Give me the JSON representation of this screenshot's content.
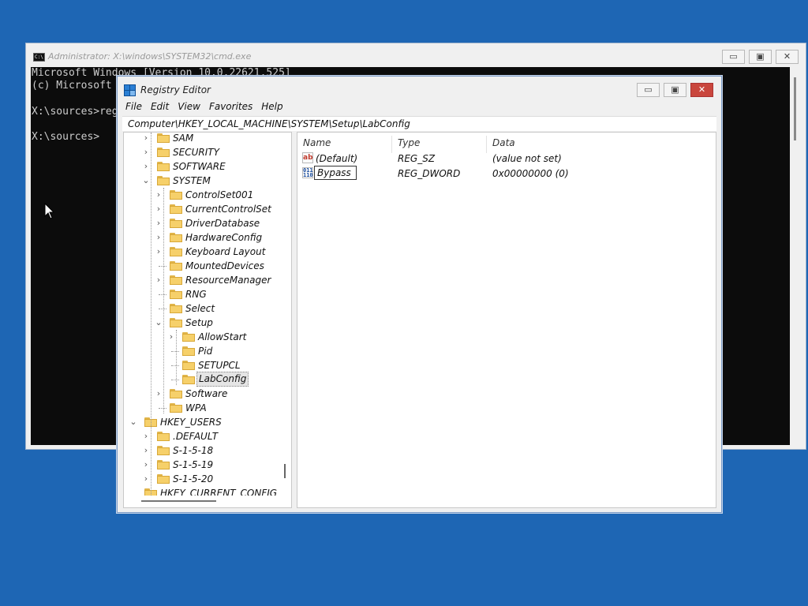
{
  "cmd": {
    "title": "Administrator: X:\\windows\\SYSTEM32\\cmd.exe",
    "console_lines": [
      "Microsoft Windows [Version 10.0.22621.525]",
      "(c) Microsoft",
      "",
      "X:\\sources>reg",
      "",
      "X:\\sources>"
    ],
    "buttons": {
      "minimize": "▭",
      "maximize": "▣",
      "close": "✕"
    }
  },
  "regedit": {
    "title": "Registry Editor",
    "buttons": {
      "minimize": "▭",
      "maximize": "▣",
      "close": "✕"
    },
    "menu": [
      "File",
      "Edit",
      "View",
      "Favorites",
      "Help"
    ],
    "address": "Computer\\HKEY_LOCAL_MACHINE\\SYSTEM\\Setup\\LabConfig",
    "tree": [
      {
        "label": "SAM",
        "expander": "›"
      },
      {
        "label": "SECURITY",
        "expander": "›"
      },
      {
        "label": "SOFTWARE",
        "expander": "›"
      },
      {
        "label": "SYSTEM",
        "expander": "⌄"
      },
      {
        "label": "ControlSet001",
        "expander": "›"
      },
      {
        "label": "CurrentControlSet",
        "expander": "›"
      },
      {
        "label": "DriverDatabase",
        "expander": "›"
      },
      {
        "label": "HardwareConfig",
        "expander": "›"
      },
      {
        "label": "Keyboard Layout",
        "expander": "›"
      },
      {
        "label": "MountedDevices",
        "expander": ""
      },
      {
        "label": "ResourceManager",
        "expander": "›"
      },
      {
        "label": "RNG",
        "expander": ""
      },
      {
        "label": "Select",
        "expander": ""
      },
      {
        "label": "Setup",
        "expander": "⌄"
      },
      {
        "label": "AllowStart",
        "expander": "›"
      },
      {
        "label": "Pid",
        "expander": ""
      },
      {
        "label": "SETUPCL",
        "expander": ""
      },
      {
        "label": "LabConfig",
        "expander": "",
        "selected": true
      },
      {
        "label": "Software",
        "expander": "›"
      },
      {
        "label": "WPA",
        "expander": ""
      },
      {
        "label": "HKEY_USERS",
        "expander": "⌄"
      },
      {
        "label": ".DEFAULT",
        "expander": "›"
      },
      {
        "label": "S-1-5-18",
        "expander": "›"
      },
      {
        "label": "S-1-5-19",
        "expander": "›"
      },
      {
        "label": "S-1-5-20",
        "expander": "›"
      },
      {
        "label": "HKEY_CURRENT_CONFIG",
        "expander": ""
      }
    ],
    "columns": {
      "name": "Name",
      "type": "Type",
      "data": "Data"
    },
    "values": [
      {
        "icon": "string-value-icon",
        "icon_text": "ab",
        "name": "(Default)",
        "type": "REG_SZ",
        "data": "(value not set)",
        "renaming": false
      },
      {
        "icon": "dword-value-icon",
        "icon_text": "011\n110",
        "name": "Bypass",
        "type": "REG_DWORD",
        "data": "0x00000000 (0)",
        "renaming": true
      }
    ]
  },
  "colors": {
    "desktop": "#1e66b4",
    "console_bg": "#0c0c0c",
    "console_text": "#cccccc",
    "close_button": "#c9463d",
    "folder": "#f6d06a"
  }
}
